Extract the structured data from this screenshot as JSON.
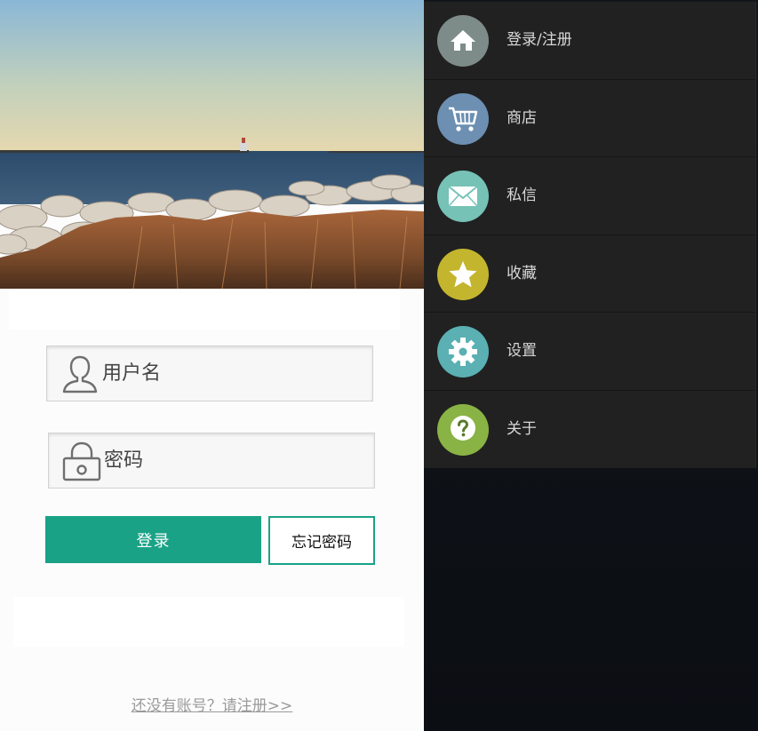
{
  "login": {
    "username_placeholder": "用户名",
    "password_placeholder": "密码",
    "login_label": "登录",
    "forgot_label": "忘记密码",
    "register_link": "还没有账号？请注册>>"
  },
  "drawer": {
    "items": [
      {
        "label": "登录/注册",
        "icon": "home-icon",
        "color": "#7d8c89"
      },
      {
        "label": "商店",
        "icon": "cart-icon",
        "color": "#6c8fb2"
      },
      {
        "label": "私信",
        "icon": "mail-icon",
        "color": "#76c2b6"
      },
      {
        "label": "收藏",
        "icon": "star-icon",
        "color": "#c4b52f"
      },
      {
        "label": "设置",
        "icon": "gear-icon",
        "color": "#5ab0b2"
      },
      {
        "label": "关于",
        "icon": "help-icon",
        "color": "#89b344"
      }
    ]
  },
  "colors": {
    "accent": "#1aa287",
    "drawer_bg": "#212121",
    "register_link": "#9a9a9a"
  }
}
